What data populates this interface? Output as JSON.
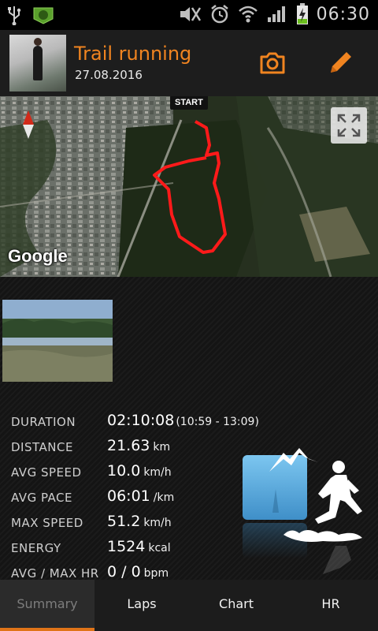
{
  "status_bar": {
    "time": "06:30",
    "icons": [
      "usb-icon",
      "app-badge-icon",
      "silent-mode-icon",
      "alarm-icon",
      "wifi-icon",
      "signal-icon",
      "battery-charging-icon"
    ]
  },
  "header": {
    "title": "Trail running",
    "date": "27.08.2016",
    "actions": [
      "camera-icon",
      "edit-icon"
    ]
  },
  "map": {
    "start_label": "START",
    "attribution": "Google",
    "route_color": "#ff1a1a"
  },
  "stats": [
    {
      "label": "DURATION",
      "value": "02:10:08",
      "extra": "(10:59 - 13:09)",
      "unit": ""
    },
    {
      "label": "DISTANCE",
      "value": "21.63",
      "unit": "km"
    },
    {
      "label": "AVG SPEED",
      "value": "10.0",
      "unit": "km/h"
    },
    {
      "label": "AVG PACE",
      "value": "06:01",
      "unit": "/km"
    },
    {
      "label": "MAX SPEED",
      "value": "51.2",
      "unit": "km/h"
    },
    {
      "label": "ENERGY",
      "value": "1524",
      "unit": "kcal"
    },
    {
      "label": "AVG / MAX HR",
      "value": "0 / 0",
      "unit": "bpm"
    }
  ],
  "tabs": [
    {
      "label": "Summary",
      "active": true
    },
    {
      "label": "Laps",
      "active": false
    },
    {
      "label": "Chart",
      "active": false
    },
    {
      "label": "HR",
      "active": false
    }
  ],
  "colors": {
    "accent": "#f08420",
    "tab_indicator": "#e07418"
  }
}
